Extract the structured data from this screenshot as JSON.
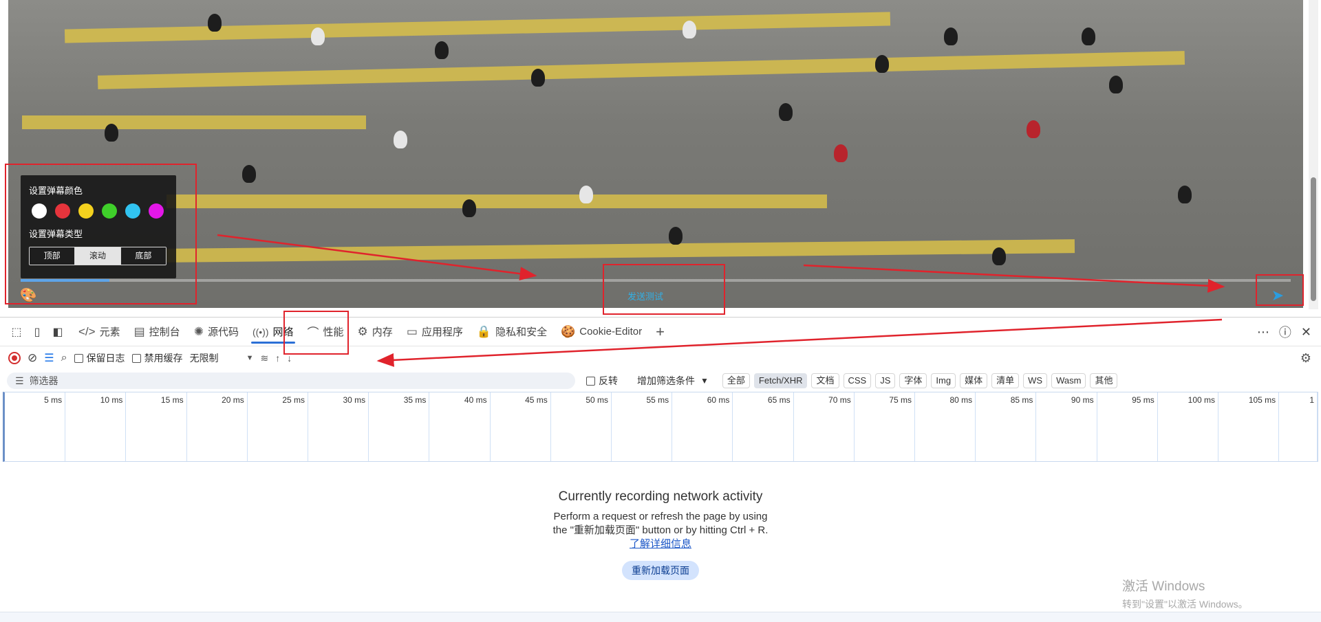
{
  "video": {
    "danmaku": {
      "color_title": "设置弹幕颜色",
      "type_title": "设置弹幕类型",
      "colors": [
        "#ffffff",
        "#e6343c",
        "#f4d11e",
        "#3fcf2a",
        "#31c3f0",
        "#e317e8"
      ],
      "types": [
        "顶部",
        "滚动",
        "底部"
      ]
    },
    "send_text": "发送测试",
    "palette_icon": "palette-icon",
    "send_icon": "paper-plane-icon"
  },
  "devtools": {
    "tabs": [
      {
        "label": "元素",
        "icon": "code-icon",
        "glyph": "</>"
      },
      {
        "label": "控制台",
        "icon": "console-icon",
        "glyph": "▤"
      },
      {
        "label": "源代码",
        "icon": "bug-icon",
        "glyph": "✺"
      },
      {
        "label": "网络",
        "icon": "wifi-icon",
        "glyph": "((•))"
      },
      {
        "label": "性能",
        "icon": "performance-icon",
        "glyph": "⌒"
      },
      {
        "label": "内存",
        "icon": "memory-icon",
        "glyph": "⚙"
      },
      {
        "label": "应用程序",
        "icon": "application-icon",
        "glyph": "▭"
      },
      {
        "label": "隐私和安全",
        "icon": "lock-icon",
        "glyph": "🔒"
      },
      {
        "label": "Cookie-Editor",
        "icon": "cookie-icon",
        "glyph": "🍪"
      }
    ],
    "active_tab": "网络",
    "toolbar": {
      "preserve_log": "保留日志",
      "disable_cache": "禁用缓存",
      "throttle": "无限制"
    },
    "filter": {
      "placeholder": "筛选器",
      "invert": "反转",
      "add_filter": "增加筛选条件",
      "types": [
        "全部",
        "Fetch/XHR",
        "文档",
        "CSS",
        "JS",
        "字体",
        "Img",
        "媒体",
        "清单",
        "WS",
        "Wasm",
        "其他"
      ],
      "active_type": "Fetch/XHR"
    },
    "timeline_ticks": [
      "5 ms",
      "10 ms",
      "15 ms",
      "20 ms",
      "25 ms",
      "30 ms",
      "35 ms",
      "40 ms",
      "45 ms",
      "50 ms",
      "55 ms",
      "60 ms",
      "65 ms",
      "70 ms",
      "75 ms",
      "80 ms",
      "85 ms",
      "90 ms",
      "95 ms",
      "100 ms",
      "105 ms",
      "1"
    ],
    "empty": {
      "title": "Currently recording network activity",
      "line1": "Perform a request or refresh the page by using the \"重新加载页面\" button or by hitting Ctrl + R.",
      "link": "了解详细信息",
      "button": "重新加载页面"
    }
  },
  "watermark": {
    "line1": "激活 Windows",
    "line2": "转到\"设置\"以激活 Windows。"
  }
}
